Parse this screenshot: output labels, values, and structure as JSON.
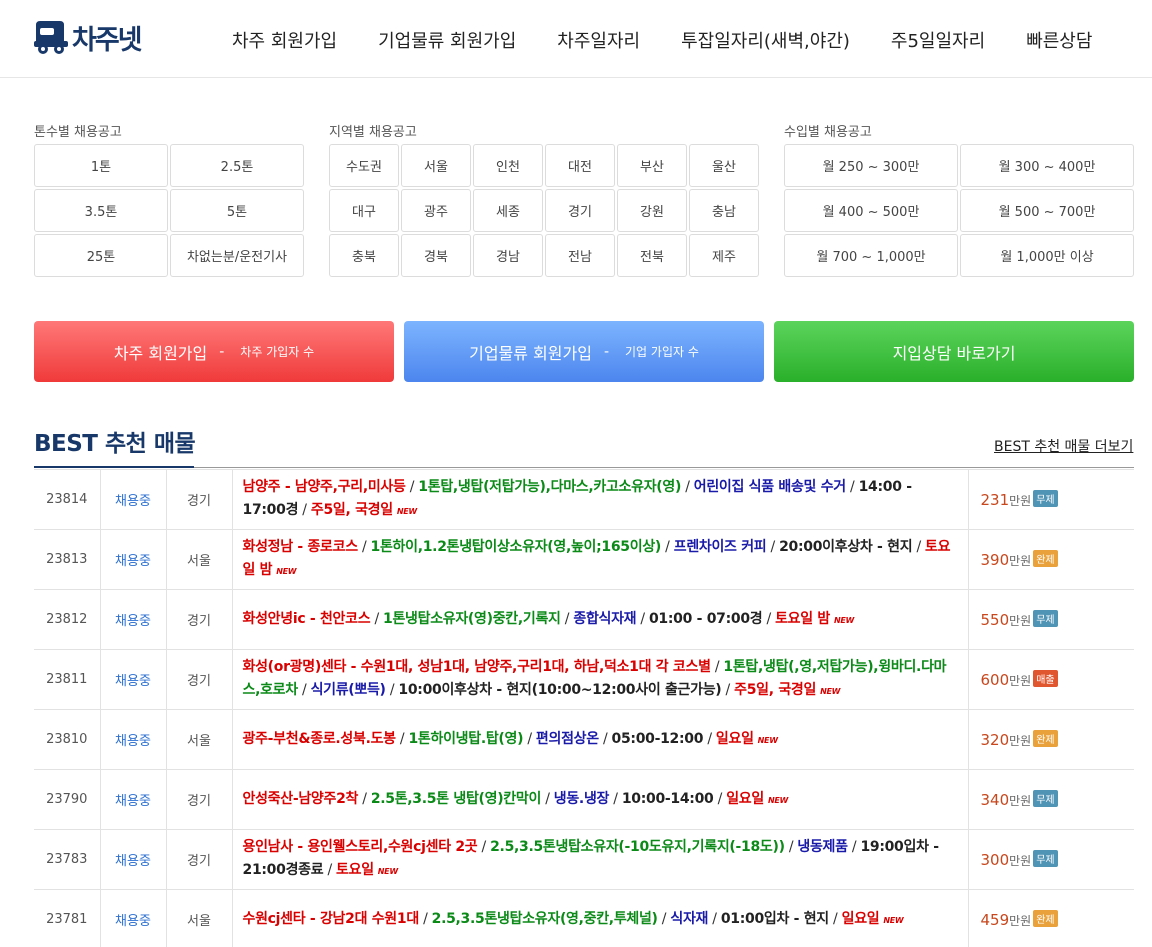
{
  "header": {
    "logo_text": "차주넷",
    "nav": [
      "차주 회원가입",
      "기업물류 회원가입",
      "차주일자리",
      "투잡일자리(새벽,야간)",
      "주5일일자리",
      "빠른상담"
    ]
  },
  "filters": {
    "tonnage": {
      "label": "톤수별 채용공고",
      "items": [
        "1톤",
        "2.5톤",
        "3.5톤",
        "5톤",
        "25톤",
        "차없는분/운전기사"
      ]
    },
    "region": {
      "label": "지역별 채용공고",
      "items": [
        "수도권",
        "서울",
        "인천",
        "대전",
        "부산",
        "울산",
        "대구",
        "광주",
        "세종",
        "경기",
        "강원",
        "충남",
        "충북",
        "경북",
        "경남",
        "전남",
        "전북",
        "제주"
      ]
    },
    "income": {
      "label": "수입별 채용공고",
      "items": [
        "월 250 ~ 300만",
        "월 300 ~ 400만",
        "월 400 ~ 500만",
        "월 500 ~ 700만",
        "월 700 ~ 1,000만",
        "월 1,000만 이상"
      ]
    }
  },
  "cta": {
    "driver": {
      "label": "차주 회원가입",
      "dash": "-",
      "sub": "차주 가입자 수"
    },
    "company": {
      "label": "기업물류 회원가입",
      "dash": "-",
      "sub": "기업 가입자 수"
    },
    "consult": {
      "label": "지입상담 바로가기"
    }
  },
  "best": {
    "title": "BEST 추천 매물",
    "more": "BEST 추천 매물 더보기",
    "new_tag": "NEW",
    "won": "만원",
    "rows": [
      {
        "id": "23814",
        "status": "채용중",
        "region": "경기",
        "route": "남양주 - 남양주,구리,미사등",
        "vehicle": "1톤탑,냉탑(저탑가능),다마스,카고소유자(영)",
        "goods": "어린이집 식품 배송및 수거",
        "time": "14:00 - 17:00경",
        "days": "주5일, 국경일",
        "pay": "231",
        "badge": "무제",
        "badge_color": "#4f93b5"
      },
      {
        "id": "23813",
        "status": "채용중",
        "region": "서울",
        "route": "화성정남 - 종로코스",
        "vehicle": "1톤하이,1.2톤냉탑이상소유자(영,높이;165이상)",
        "goods": "프렌차이즈 커피",
        "time": "20:00이후상차 - 현지",
        "days": "토요일 밤",
        "pay": "390",
        "badge": "완제",
        "badge_color": "#e9a13b"
      },
      {
        "id": "23812",
        "status": "채용중",
        "region": "경기",
        "route": "화성안녕ic - 천안코스",
        "vehicle": "1톤냉탑소유자(영)중칸,기록지",
        "goods": "종합식자재",
        "time": "01:00 - 07:00경",
        "days": "토요일 밤",
        "pay": "550",
        "badge": "무제",
        "badge_color": "#4f93b5"
      },
      {
        "id": "23811",
        "status": "채용중",
        "region": "경기",
        "route": "화성(or광명)센타 - 수원1대, 성남1대, 남양주,구리1대, 하남,덕소1대 각 코스별",
        "vehicle": "1톤탑,냉탑(,영,저탑가능),윙바디.다마스,호로차",
        "goods": "식기류(뽀득)",
        "time": "10:00이후상차 - 현지(10:00~12:00사이 출근가능)",
        "days": "주5일, 국경일",
        "pay": "600",
        "badge": "매출",
        "badge_color": "#e0562f"
      },
      {
        "id": "23810",
        "status": "채용중",
        "region": "서울",
        "route": "광주-부천&종로.성북.도봉",
        "vehicle": "1톤하이냉탑.탑(영)",
        "goods": "편의점상온",
        "time": "05:00-12:00",
        "days": "일요일",
        "pay": "320",
        "badge": "완제",
        "badge_color": "#e9a13b"
      },
      {
        "id": "23790",
        "status": "채용중",
        "region": "경기",
        "route": "안성죽산-남양주2착",
        "vehicle": "2.5톤,3.5톤 냉탑(영)칸막이",
        "goods": "냉동.냉장",
        "time": "10:00-14:00",
        "days": "일요일",
        "pay": "340",
        "badge": "무제",
        "badge_color": "#4f93b5"
      },
      {
        "id": "23783",
        "status": "채용중",
        "region": "경기",
        "route": "용인남사 - 용인웰스토리,수원cj센타 2곳",
        "vehicle": "2.5,3.5톤냉탑소유자(-10도유지,기록지(-18도))",
        "goods": "냉동제품",
        "time": "19:00입차 - 21:00경종료",
        "days": "토요일",
        "pay": "300",
        "badge": "무제",
        "badge_color": "#4f93b5"
      },
      {
        "id": "23781",
        "status": "채용중",
        "region": "서울",
        "route": "수원cj센타 - 강남2대 수원1대",
        "vehicle": "2.5,3.5톤냉탑소유자(영,중칸,투체널)",
        "goods": "식자재",
        "time": "01:00입차 - 현지",
        "days": "일요일",
        "pay": "459",
        "badge": "완제",
        "badge_color": "#e9a13b"
      }
    ]
  }
}
